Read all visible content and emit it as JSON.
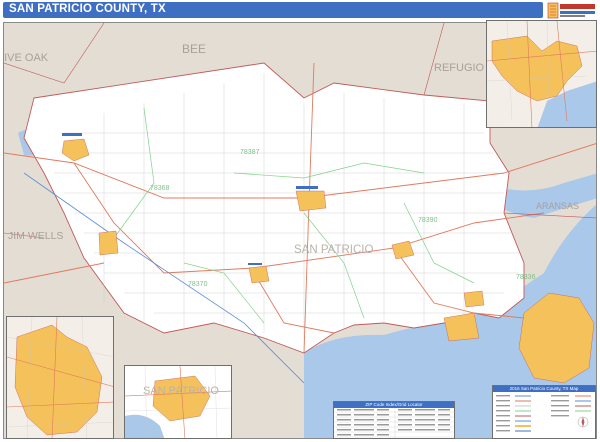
{
  "header": {
    "title": "SAN PATRICIO COUNTY, TX",
    "logo_icon": "map-publisher-logo-icon"
  },
  "map": {
    "county_label": "SAN PATRICIO",
    "neighbor_counties": {
      "bee": "BEE",
      "refugio": "REFUGIO",
      "live_oak": "LIVE OAK",
      "jim_wells": "JIM WELLS",
      "aransas": "ARANSAS"
    },
    "zip_labels": {
      "z1": "78387",
      "z2": "78368",
      "z3": "78390",
      "z4": "78370",
      "z5": "78336"
    },
    "colors": {
      "county_fill": "#ffffff",
      "outside_fill": "#e4ddd3",
      "water": "#a9c8ea",
      "urban": "#f5c15a",
      "road_major": "#e07a5f",
      "road_minor": "#c9c9c9",
      "zip_boundary": "#7fd38a",
      "county_boundary": "#c05a5a",
      "title_bar": "#3f6fc3"
    }
  },
  "inset_bottom": {
    "label": "SAN PATRICIO"
  },
  "legend": {
    "title": "2016 San Patricio County, TX Map"
  },
  "zip_index": {
    "title": "ZIP Code Index/Grid Locator"
  }
}
